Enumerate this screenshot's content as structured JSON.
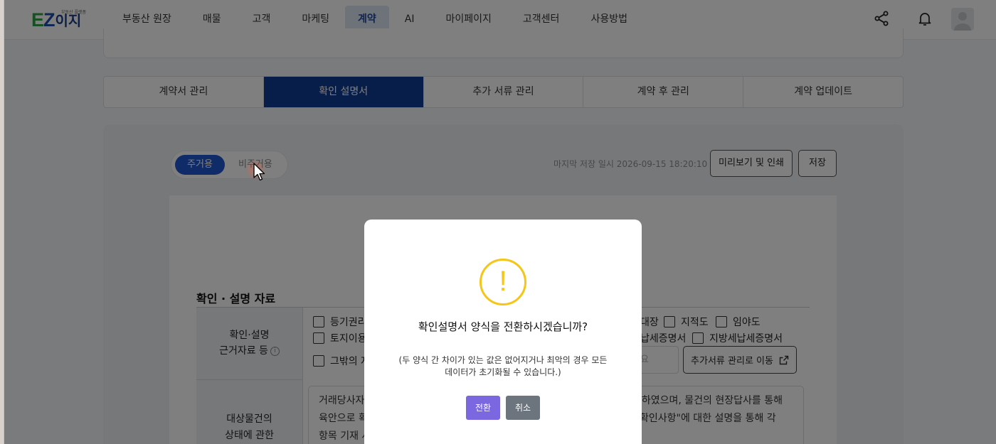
{
  "header": {
    "logo_ez_e": "E",
    "logo_ez_z": "Z",
    "logo_kr": "이지",
    "logo_sub": "부동산 플랫폼",
    "nav": [
      "부동산 원장",
      "매물",
      "고객",
      "마케팅",
      "계약",
      "AI",
      "마이페이지",
      "고객센터",
      "사용방법"
    ],
    "active_nav": "계약",
    "icons": [
      "share-icon",
      "bell-icon",
      "avatar"
    ]
  },
  "tabs": [
    "계약서 관리",
    "확인 설명서",
    "추가 서류 관리",
    "계약 후 관리",
    "계약 업데이트"
  ],
  "active_tab": "확인 설명서",
  "toolbar": {
    "toggle_on": "주거용",
    "toggle_off": "비주거용",
    "saved_time": "마지막 저장 일시 2026-09-15 18:20:10",
    "preview_print": "미리보기 및 인쇄",
    "save": "저장"
  },
  "section": {
    "title": "확인 · 설명 자료",
    "row1_label_line1": "확인·설명",
    "row1_label_line2": "근거자료 등",
    "row2_label_line1": "대상물건의",
    "row2_label_line2": "상태에 관한",
    "checkboxes_left": [
      "등기권리",
      "토지이용",
      "그밖의 자"
    ],
    "checkboxes_right_row1": [
      "대장",
      "지적도",
      "임야도"
    ],
    "checkboxes_right_row2_partial": "납세증명서",
    "checkbox_right_row2": "지방세납세증명서",
    "input_partial": "요",
    "move_button": "추가서류 관리로 이동",
    "desc_line1_left": "거래당사자",
    "desc_line1_right": "인하였으며, 물건의 현장답사를 통해",
    "desc_line2_left": "육안으로 확",
    "desc_line2_right": "확인사항\"에 대한 설명을 통해 각",
    "desc_line3_left": "항목 기재 사"
  },
  "modal": {
    "icon": "!",
    "title": "확인설명서 양식을 전환하시겠습니까?",
    "desc": "(두 양식 간 차이가 있는 값은 없어지거나 최악의 경우 모든 데이터가 초기화될 수 있습니다.)",
    "confirm": "전환",
    "cancel": "취소"
  },
  "colors": {
    "primary_tab": "#0f3c95",
    "toggle_active": "#1f57d1",
    "confirm_button": "#7b67e0",
    "cancel_button": "#6c757d",
    "warning": "#f5c518"
  }
}
